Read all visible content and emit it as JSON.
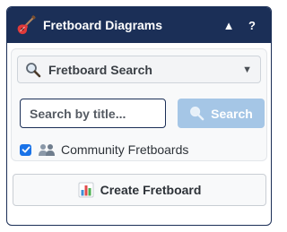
{
  "header": {
    "title": "Fretboard Diagrams",
    "collapse_label": "▲",
    "help_label": "?",
    "app_icon": "guitar-icon"
  },
  "search_panel": {
    "dropdown_label": "Fretboard Search",
    "dropdown_icon": "magnifier-icon",
    "dropdown_caret": "▼",
    "input_value": "",
    "input_placeholder": "Search by title...",
    "search_button_label": "Search",
    "search_button_icon": "magnifier-icon",
    "community_label": "Community Fretboards",
    "community_checked": true,
    "community_icon": "people-icon"
  },
  "create_button": {
    "label": "Create Fretboard",
    "icon": "bar-chart-icon"
  },
  "colors": {
    "header_bg": "#1b2f57",
    "search_button_bg": "#a5c6e6",
    "checkbox_accent": "#1a73e8"
  }
}
